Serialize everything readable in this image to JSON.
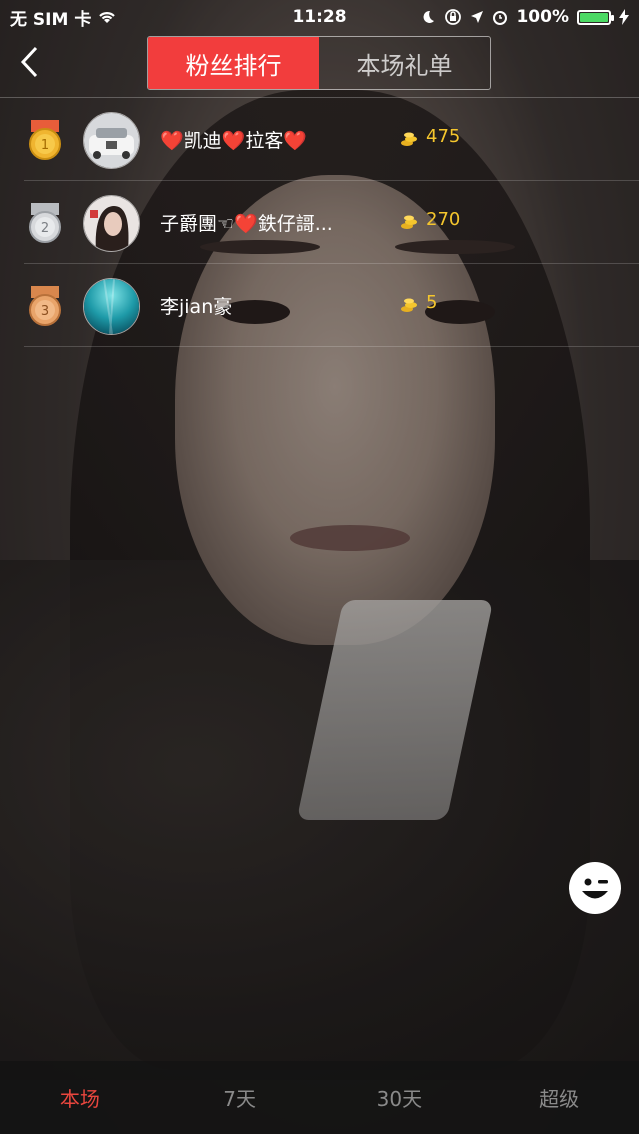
{
  "status_bar": {
    "carrier": "无 SIM 卡",
    "time": "11:28",
    "battery": "100%"
  },
  "header": {
    "tabs": [
      {
        "label": "粉丝排行",
        "active": true
      },
      {
        "label": "本场礼单",
        "active": false
      }
    ]
  },
  "ranking": [
    {
      "rank": 1,
      "name": "❤️凯迪❤️拉客❤️",
      "score": "475",
      "medal": "gold-medal-icon"
    },
    {
      "rank": 2,
      "name": "子爵團☜❤️鉄仔謌...",
      "score": "270",
      "medal": "silver-medal-icon"
    },
    {
      "rank": 3,
      "name": "李jian豪",
      "score": "5",
      "medal": "bronze-medal-icon"
    }
  ],
  "bottom_tabs": [
    {
      "label": "本场",
      "active": true
    },
    {
      "label": "7天",
      "active": false
    },
    {
      "label": "30天",
      "active": false
    },
    {
      "label": "超级",
      "active": false
    }
  ],
  "colors": {
    "accent": "#f23d3d",
    "score": "#f5c62d",
    "bottom_active": "#e8463e"
  }
}
